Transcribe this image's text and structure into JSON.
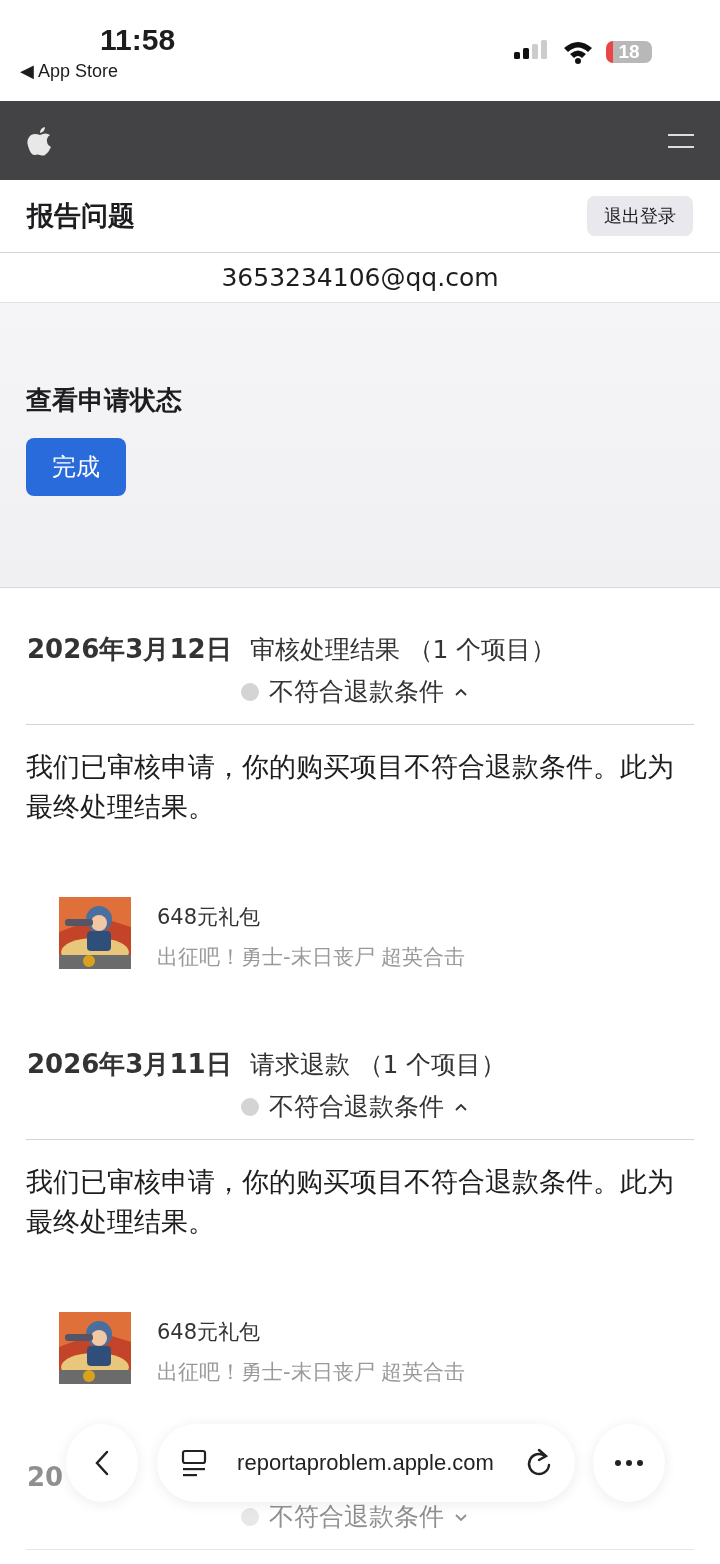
{
  "status_bar": {
    "time": "11:58",
    "back_label": "◀ App Store",
    "battery": "18"
  },
  "page": {
    "title": "报告问题",
    "sign_out": "退出登录",
    "email": "3653234106@qq.com",
    "section_title": "查看申请状态",
    "done_button": "完成"
  },
  "records": [
    {
      "date": "2026年3月12日",
      "title": "审核处理结果 （1 个项目）",
      "status": "不符合退款条件",
      "expanded": true,
      "message": "我们已审核申请，你的购买项目不符合退款条件。此为最终处理结果。",
      "item": {
        "name": "648元礼包",
        "game": "出征吧！勇士-末日丧尸 超英合击"
      }
    },
    {
      "date": "2026年3月11日",
      "title": "请求退款 （1 个项目）",
      "status": "不符合退款条件",
      "expanded": true,
      "message": "我们已审核申请，你的购买项目不符合退款条件。此为最终处理结果。",
      "item": {
        "name": "648元礼包",
        "game": "出征吧！勇士-末日丧尸 超英合击"
      }
    },
    {
      "date": "20",
      "status": "不符合退款条件",
      "expanded": false
    }
  ],
  "browser_bar": {
    "url": "reportaproblem.apple.com"
  }
}
